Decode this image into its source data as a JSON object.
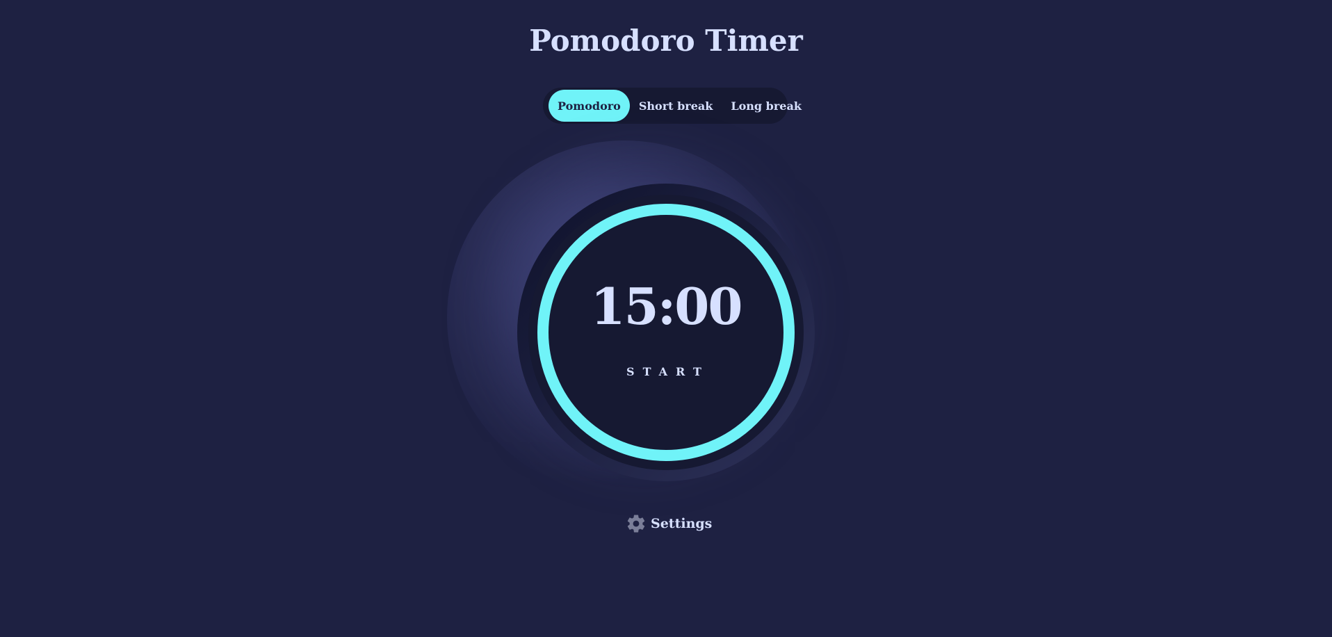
{
  "app": {
    "title": "Pomodoro Timer"
  },
  "modes": [
    {
      "label": "Pomodoro",
      "active": true
    },
    {
      "label": "Short break",
      "active": false
    },
    {
      "label": "Long break",
      "active": false
    }
  ],
  "timer": {
    "time": "15:00",
    "action_label": "START",
    "progress": 1.0
  },
  "settings": {
    "label": "Settings",
    "icon": "gear-icon"
  },
  "colors": {
    "background": "#1e2142",
    "accent": "#70f3f8",
    "text": "#d7e0ff",
    "dial": "#161932"
  }
}
